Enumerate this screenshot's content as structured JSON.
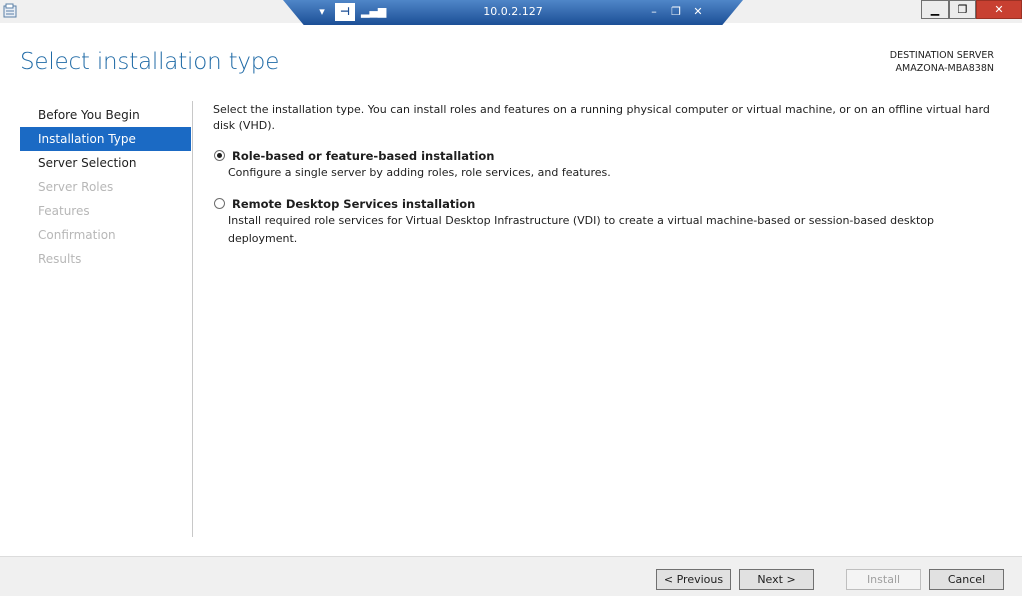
{
  "rdp_bar": {
    "host": "10.0.2.127",
    "dropdown_glyph": "▾",
    "pin_glyph": "⊣",
    "signal_glyph": "▂▄▆",
    "minimize_glyph": "–",
    "restore_glyph": "❐",
    "close_glyph": "✕"
  },
  "window_controls": {
    "minimize_glyph": "▁",
    "maximize_glyph": "❐",
    "close_glyph": "✕"
  },
  "header": {
    "title": "Select installation type",
    "destination_label": "DESTINATION SERVER",
    "destination_value": "AMAZONA-MBA838N"
  },
  "nav": {
    "items": [
      {
        "label": "Before You Begin",
        "state": "normal"
      },
      {
        "label": "Installation Type",
        "state": "active"
      },
      {
        "label": "Server Selection",
        "state": "normal"
      },
      {
        "label": "Server Roles",
        "state": "disabled"
      },
      {
        "label": "Features",
        "state": "disabled"
      },
      {
        "label": "Confirmation",
        "state": "disabled"
      },
      {
        "label": "Results",
        "state": "disabled"
      }
    ]
  },
  "content": {
    "intro": "Select the installation type. You can install roles and features on a running physical computer or virtual machine, or on an offline virtual hard disk (VHD).",
    "options": [
      {
        "title": "Role-based or feature-based installation",
        "description": "Configure a single server by adding roles, role services, and features.",
        "selected": true
      },
      {
        "title": "Remote Desktop Services installation",
        "description": "Install required role services for Virtual Desktop Infrastructure (VDI) to create a virtual machine-based or session-based desktop deployment.",
        "selected": false
      }
    ]
  },
  "footer": {
    "previous_label": "< Previous",
    "next_label": "Next >",
    "install_label": "Install",
    "cancel_label": "Cancel"
  },
  "colors": {
    "accent": "#1b6ac4",
    "title": "#1f6aa6",
    "close": "#c84031"
  }
}
